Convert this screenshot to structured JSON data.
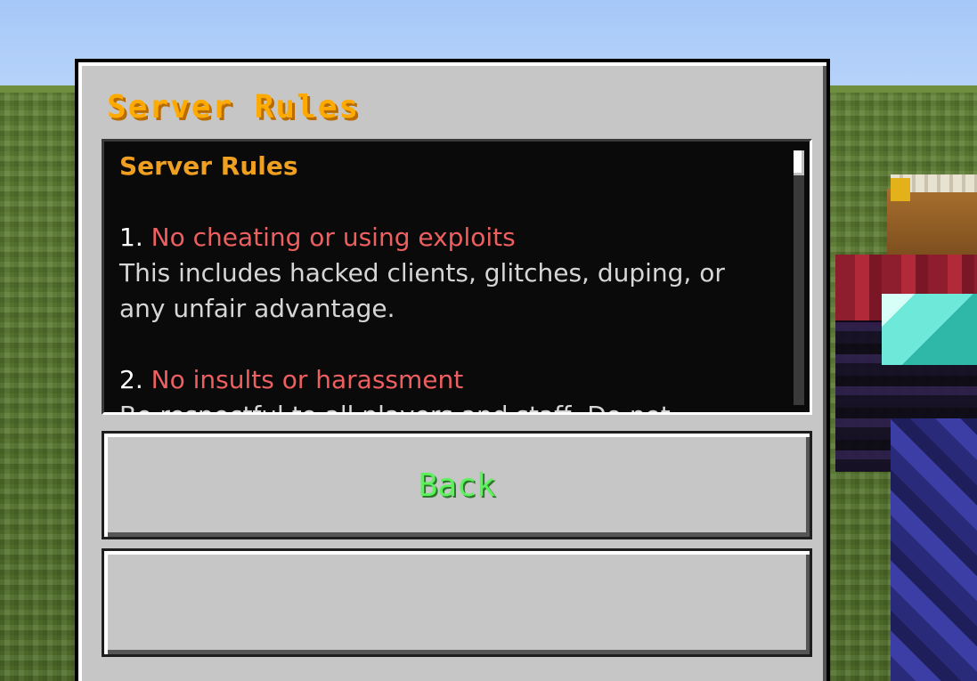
{
  "dialog": {
    "title": "Server Rules"
  },
  "content": {
    "heading": "Server Rules",
    "rules": [
      {
        "number": "1.",
        "title": "No cheating or using exploits",
        "description_line1": "This includes hacked clients, glitches, duping, or",
        "description_line2": "any unfair advantage."
      },
      {
        "number": "2.",
        "title": "No insults or harassment",
        "description_line1": "Be respectful to all players and staff. Do not"
      }
    ]
  },
  "buttons": {
    "back_label": "Back",
    "second_label": ""
  },
  "colors": {
    "title": "#ffaa00",
    "heading": "#f0a020",
    "rule_title": "#ee5f5f",
    "back_label": "#5cf25c"
  }
}
